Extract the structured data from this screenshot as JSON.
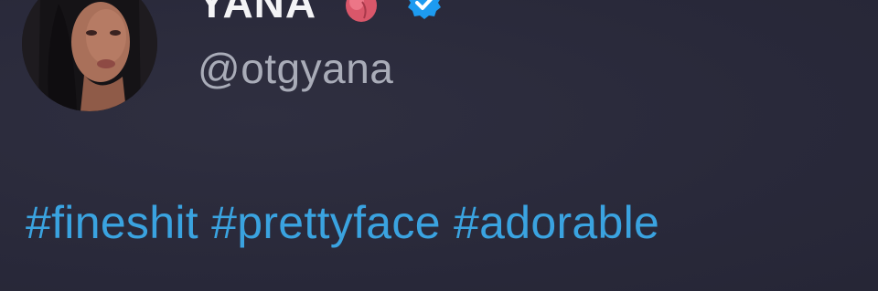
{
  "author": {
    "display_name": "YANA",
    "handle": "@otgyana",
    "verified": true
  },
  "tweet": {
    "hashtags": [
      "#fineshit",
      "#prettyface",
      "#adorable"
    ]
  },
  "colors": {
    "background": "#2b2b3b",
    "hashtag": "#3aa3e0",
    "handle": "#a9acb8",
    "name": "#f4f4f6",
    "verified": "#1d9bf0"
  },
  "icons": {
    "heart": "anatomical-heart-icon",
    "verified": "verified-badge-icon"
  }
}
